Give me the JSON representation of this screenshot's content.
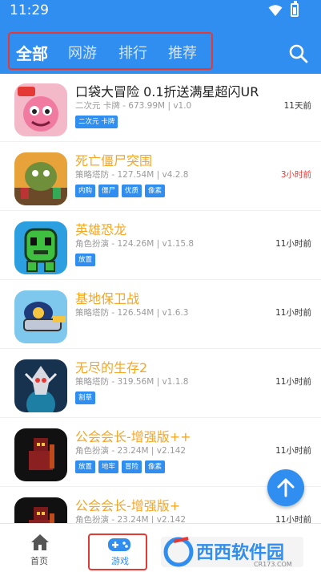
{
  "status_bar": {
    "time": "11:29"
  },
  "tabs": [
    {
      "label": "全部"
    },
    {
      "label": "网游"
    },
    {
      "label": "排行"
    },
    {
      "label": "推荐"
    }
  ],
  "colors": {
    "primary": "#2f8ef0",
    "highlight_box": "#e53935",
    "title_yellow": "#f5a623",
    "time_red": "#e53935"
  },
  "games": [
    {
      "name": "口袋大冒险 0.1折送满星超闪UR",
      "meta": "二次元 卡牌 - 673.99M | v1.0",
      "tags": [
        "二次元 卡牌"
      ],
      "time": "11天前",
      "name_color": "#222222",
      "time_color": "#333333"
    },
    {
      "name": "死亡僵尸突围",
      "meta": "策略塔防 - 127.54M | v4.2.8",
      "tags": [
        "内购",
        "僵尸",
        "优质",
        "像素"
      ],
      "time": "3小时前",
      "name_color": "#f5a623",
      "time_color": "#e53935"
    },
    {
      "name": "英雄恐龙",
      "meta": "角色扮演 - 124.26M | v1.15.8",
      "tags": [
        "放置"
      ],
      "time": "11小时前",
      "name_color": "#f5a623",
      "time_color": "#333333"
    },
    {
      "name": "基地保卫战",
      "meta": "策略塔防 - 126.54M | v1.6.3",
      "tags": [],
      "time": "11小时前",
      "name_color": "#f5a623",
      "time_color": "#333333"
    },
    {
      "name": "无尽的生存2",
      "meta": "策略塔防 - 319.56M | v1.1.8",
      "tags": [
        "割草"
      ],
      "time": "11小时前",
      "name_color": "#f5a623",
      "time_color": "#333333"
    },
    {
      "name": "公会会长-增强版++",
      "meta": "角色扮演 - 23.24M | v2.142",
      "tags": [
        "放置",
        "地牢",
        "冒险",
        "像素"
      ],
      "time": "11小时前",
      "name_color": "#f5a623",
      "time_color": "#333333"
    },
    {
      "name": "公会会长-增强版+",
      "meta": "角色扮演 - 23.24M | v2.142",
      "tags": [],
      "time": "11小时前",
      "name_color": "#f5a623",
      "time_color": "#333333"
    }
  ],
  "bottom_nav": [
    {
      "label": "首页",
      "icon": "home-icon"
    },
    {
      "label": "游戏",
      "icon": "gamepad-icon"
    }
  ],
  "watermark": {
    "text": "西西软件园",
    "url_text": "CR173.COM"
  }
}
